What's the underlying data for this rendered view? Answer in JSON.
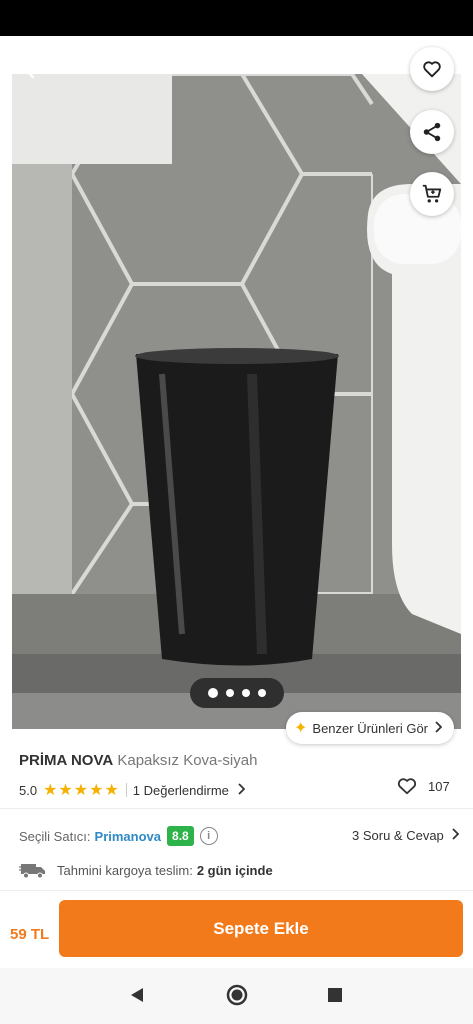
{
  "gallery": {
    "dots": [
      true,
      false,
      false,
      false
    ],
    "similar_label": "Benzer Ürünleri Gör"
  },
  "product": {
    "brand": "PRİMA NOVA",
    "name": "Kapaksız Kova-siyah",
    "rating": "5.0",
    "stars": "★★★★★",
    "reviews_label": "1 Değerlendirme",
    "favorites_count": "107"
  },
  "seller": {
    "label": "Seçili Satıcı:",
    "name": "Primanova",
    "score": "8.8",
    "qa_label": "3 Soru & Cevap"
  },
  "delivery": {
    "label": "Tahmini kargoya teslim:",
    "value": "2 gün içinde"
  },
  "purchase": {
    "price": "59 TL",
    "button_label": "Sepete Ekle"
  },
  "colors": {
    "accent": "#f27a1a",
    "seller_link": "#2d8ac7",
    "score_badge": "#2db34a",
    "stars": "#f6b100"
  },
  "icons": [
    "back-arrow-icon",
    "heart-icon",
    "share-icon",
    "cart-icon",
    "sparkle-icon",
    "chevron-right-icon",
    "info-icon",
    "truck-icon",
    "nav-back-icon",
    "nav-home-icon",
    "nav-recent-icon"
  ]
}
